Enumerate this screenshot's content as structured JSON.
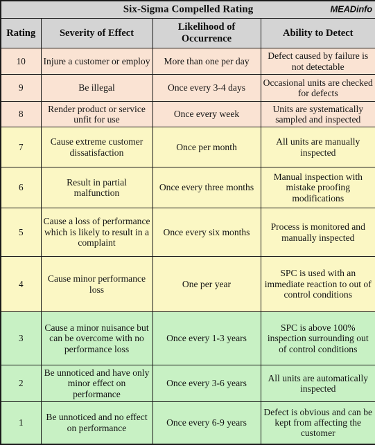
{
  "title": "Six-Sigma Compelled Rating",
  "brand": "MEADinfo",
  "columns": [
    "Rating",
    "Severity of Effect",
    "Likelihood of Occurrence",
    "Ability to Detect"
  ],
  "rows": [
    {
      "rating": "10",
      "severity": "Injure a customer or employ",
      "likelihood": "More than one per day",
      "detect": "Defect caused by failure is not detectable",
      "band": "red"
    },
    {
      "rating": "9",
      "severity": "Be illegal",
      "likelihood": "Once every 3-4 days",
      "detect": "Occasional units are checked for defects",
      "band": "red"
    },
    {
      "rating": "8",
      "severity": "Render product or service unfit for use",
      "likelihood": "Once every week",
      "detect": "Units are systematically sampled and inspected",
      "band": "red"
    },
    {
      "rating": "7",
      "severity": "Cause extreme customer dissatisfaction",
      "likelihood": "Once per month",
      "detect": "All units are manually inspected",
      "band": "yellow"
    },
    {
      "rating": "6",
      "severity": "Result in partial malfunction",
      "likelihood": "Once every three months",
      "detect": "Manual inspection with mistake proofing modifications",
      "band": "yellow"
    },
    {
      "rating": "5",
      "severity": "Cause a loss of performance which is likely to result in a complaint",
      "likelihood": "Once every six months",
      "detect": "Process is monitored and manually inspected",
      "band": "yellow"
    },
    {
      "rating": "4",
      "severity": "Cause minor performance loss",
      "likelihood": "One per year",
      "detect": "SPC is used with an immediate reaction to out of control conditions",
      "band": "yellow"
    },
    {
      "rating": "3",
      "severity": "Cause a minor nuisance but can be overcome with no performance loss",
      "likelihood": "Once every 1-3 years",
      "detect": "SPC is above 100% inspection surrounding out of control conditions",
      "band": "green"
    },
    {
      "rating": "2",
      "severity": "Be unnoticed and have only minor effect on performance",
      "likelihood": "Once every 3-6 years",
      "detect": "All units are automatically inspected",
      "band": "green"
    },
    {
      "rating": "1",
      "severity": "Be unnoticed and no effect on performance",
      "likelihood": "Once every 6-9 years",
      "detect": "Defect is obvious and can be kept from affecting the customer",
      "band": "green"
    }
  ],
  "colors": {
    "header_background": "#d4d4d4",
    "band_red": "#fae3d3",
    "band_yellow": "#fbf7c4",
    "band_green": "#c8f1c4",
    "border": "#1a1a1a"
  }
}
